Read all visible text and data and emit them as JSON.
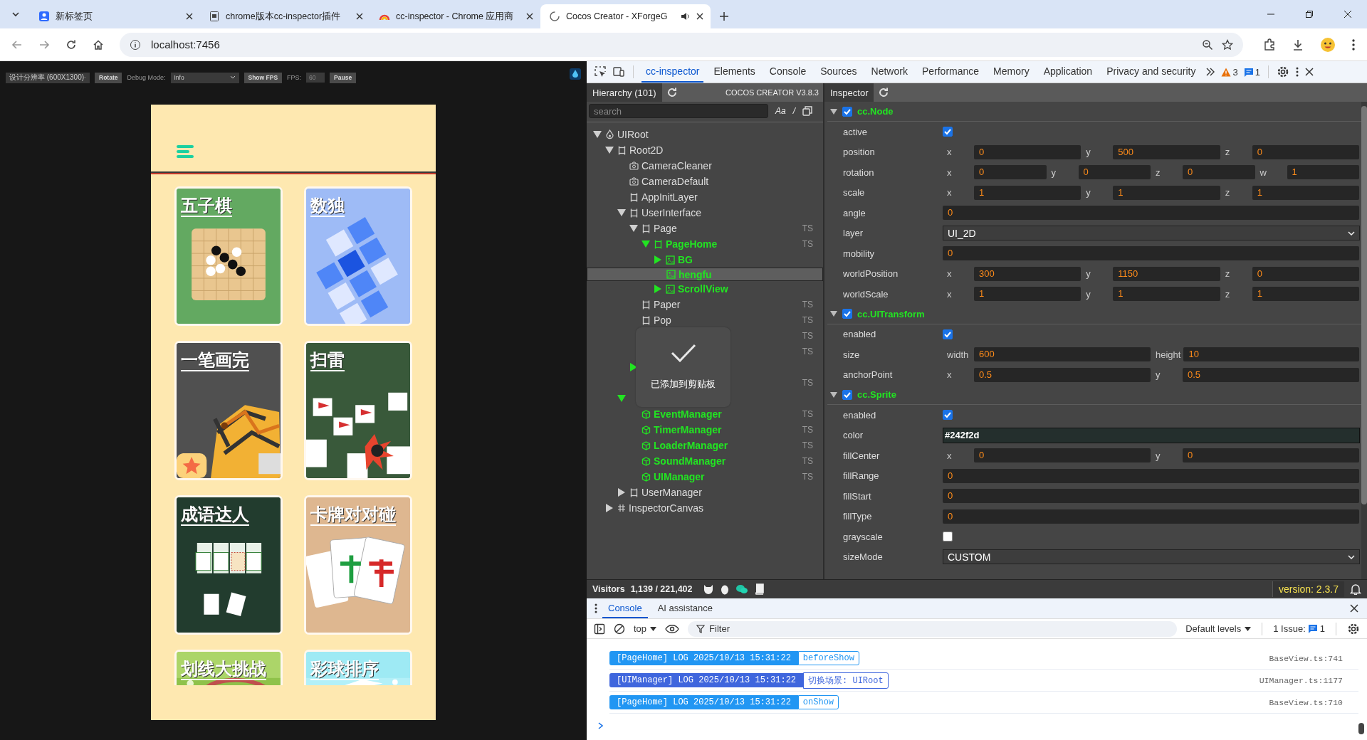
{
  "browser": {
    "tabs": [
      {
        "title": "新标签页",
        "selected": false,
        "audio": false
      },
      {
        "title": "chrome版本cc-inspector插件",
        "selected": false,
        "audio": false
      },
      {
        "title": "cc-inspector - Chrome 应用商",
        "selected": false,
        "audio": false
      },
      {
        "title": "Cocos Creator - XForgeG",
        "selected": true,
        "audio": true
      }
    ],
    "address": "localhost:7456"
  },
  "game": {
    "toolbar": {
      "resolution": "设计分辨率 (600X1300)",
      "rotate": "Rotate",
      "debug_label": "Debug Mode:",
      "debug_value": "Info",
      "show_fps": "Show FPS",
      "fps_label": "FPS:",
      "fps_value": "60",
      "pause": "Pause"
    },
    "cards": [
      {
        "title": "五子棋",
        "color": "#58a355"
      },
      {
        "title": "数独",
        "color": "#97b6f6"
      },
      {
        "title": "一笔画完",
        "color": "#434343"
      },
      {
        "title": "扫雷",
        "color": "#2b4d2c"
      },
      {
        "title": "成语达人",
        "color": "#122e1f"
      },
      {
        "title": "卡牌对对碰",
        "color": "#dcb288"
      },
      {
        "title": "划线大挑战",
        "color": "#a6d25e"
      },
      {
        "title": "彩球排序",
        "color": "#97e9f4"
      }
    ]
  },
  "devtools": {
    "tabs": [
      {
        "label": "cc-inspector",
        "selected": true
      },
      {
        "label": "Elements",
        "selected": false
      },
      {
        "label": "Console",
        "selected": false
      },
      {
        "label": "Sources",
        "selected": false
      },
      {
        "label": "Network",
        "selected": false
      },
      {
        "label": "Performance",
        "selected": false
      },
      {
        "label": "Memory",
        "selected": false
      },
      {
        "label": "Application",
        "selected": false
      },
      {
        "label": "Privacy and security",
        "selected": false
      }
    ],
    "warnings": "3",
    "messages": "1"
  },
  "hierarchy": {
    "tab": "Hierarchy (101)",
    "engine": "COCOS CREATOR V3.8.3",
    "search_placeholder": "search",
    "tools": [
      "Aa",
      "/"
    ],
    "tree": [
      {
        "name": "UIRoot",
        "kind": "root",
        "expanded": true,
        "active": false,
        "selected": false,
        "children": [
          {
            "name": "Root2D",
            "kind": "node",
            "expanded": true,
            "active": false,
            "selected": false,
            "children": [
              {
                "name": "CameraCleaner",
                "kind": "camera",
                "active": false,
                "selected": false
              },
              {
                "name": "CameraDefault",
                "kind": "camera",
                "active": false,
                "selected": false
              },
              {
                "name": "AppInitLayer",
                "kind": "node",
                "active": false,
                "selected": false
              },
              {
                "name": "UserInterface",
                "kind": "node",
                "expanded": true,
                "active": false,
                "selected": false,
                "children": [
                  {
                    "name": "Page",
                    "kind": "node",
                    "expanded": true,
                    "active": false,
                    "selected": false,
                    "tag": "TS",
                    "children": [
                      {
                        "name": "PageHome",
                        "kind": "node",
                        "expanded": true,
                        "active": true,
                        "selected": false,
                        "tag": "TS",
                        "children": [
                          {
                            "name": "BG",
                            "kind": "sprite",
                            "expanded": false,
                            "active": true,
                            "selected": false
                          },
                          {
                            "name": "hengfu",
                            "kind": "sprite",
                            "active": true,
                            "selected": true
                          },
                          {
                            "name": "ScrollView",
                            "kind": "sprite",
                            "expanded": false,
                            "active": true,
                            "selected": false
                          }
                        ]
                      }
                    ]
                  },
                  {
                    "name": "Paper",
                    "kind": "node",
                    "active": false,
                    "selected": false,
                    "tag": "TS"
                  },
                  {
                    "name": "Pop",
                    "kind": "node",
                    "active": false,
                    "selected": false,
                    "tag": "TS"
                  },
                  {
                    "active": false,
                    "selected": false,
                    "tag": "TS"
                  },
                  {
                    "active": false,
                    "selected": false,
                    "tag": "TS"
                  },
                  {
                    "expanded": false,
                    "active": true,
                    "selected": false
                  },
                  {
                    "active": false,
                    "selected": false,
                    "tag": "TS"
                  }
                ]
              },
              {
                "expanded": true,
                "active": true,
                "selected": false,
                "children": [
                  {
                    "name": "EventManager",
                    "kind": "component",
                    "active": true,
                    "selected": false,
                    "tag": "TS"
                  },
                  {
                    "name": "TimerManager",
                    "kind": "component",
                    "active": true,
                    "selected": false,
                    "tag": "TS"
                  },
                  {
                    "name": "LoaderManager",
                    "kind": "component",
                    "active": true,
                    "selected": false,
                    "tag": "TS"
                  },
                  {
                    "name": "SoundManager",
                    "kind": "component",
                    "active": true,
                    "selected": false,
                    "tag": "TS"
                  },
                  {
                    "name": "UIManager",
                    "kind": "component",
                    "active": true,
                    "selected": false,
                    "tag": "TS"
                  }
                ]
              },
              {
                "name": "UserManager",
                "kind": "node",
                "expanded": false,
                "active": false,
                "selected": false
              }
            ]
          },
          {
            "name": "InspectorCanvas",
            "kind": "canvas",
            "expanded": false,
            "active": false,
            "selected": false
          }
        ]
      }
    ]
  },
  "toast": {
    "text": "已添加到剪贴板"
  },
  "inspector": {
    "tab": "Inspector",
    "components": [
      {
        "name": "cc.Node",
        "enabled": true,
        "expanded": true,
        "props": [
          {
            "label": "active",
            "kind": "check",
            "checked": true
          },
          {
            "label": "position",
            "kind": "vector",
            "fields": [
              {
                "axis": "x",
                "value": "0"
              },
              {
                "axis": "y",
                "value": "500"
              },
              {
                "axis": "z",
                "value": "0"
              }
            ]
          },
          {
            "label": "rotation",
            "kind": "vector",
            "fields": [
              {
                "axis": "x",
                "value": "0"
              },
              {
                "axis": "y",
                "value": "0"
              },
              {
                "axis": "z",
                "value": "0"
              },
              {
                "axis": "w",
                "value": "1"
              }
            ]
          },
          {
            "label": "scale",
            "kind": "vector",
            "fields": [
              {
                "axis": "x",
                "value": "1"
              },
              {
                "axis": "y",
                "value": "1"
              },
              {
                "axis": "z",
                "value": "1"
              }
            ]
          },
          {
            "label": "angle",
            "kind": "number",
            "value": "0"
          },
          {
            "label": "layer",
            "kind": "select",
            "value": "UI_2D"
          },
          {
            "label": "mobility",
            "kind": "number",
            "value": "0"
          },
          {
            "label": "worldPosition",
            "kind": "vector",
            "fields": [
              {
                "axis": "x",
                "value": "300"
              },
              {
                "axis": "y",
                "value": "1150"
              },
              {
                "axis": "z",
                "value": "0"
              }
            ]
          },
          {
            "label": "worldScale",
            "kind": "vector",
            "fields": [
              {
                "axis": "x",
                "value": "1"
              },
              {
                "axis": "y",
                "value": "1"
              },
              {
                "axis": "z",
                "value": "1"
              }
            ]
          }
        ]
      },
      {
        "name": "cc.UITransform",
        "enabled": true,
        "expanded": true,
        "props": [
          {
            "label": "enabled",
            "kind": "check",
            "checked": true
          },
          {
            "label": "size",
            "kind": "vector",
            "fields": [
              {
                "axis": "width",
                "value": "600"
              },
              {
                "axis": "height",
                "value": "10"
              }
            ]
          },
          {
            "label": "anchorPoint",
            "kind": "vector",
            "fields": [
              {
                "axis": "x",
                "value": "0.5"
              },
              {
                "axis": "y",
                "value": "0.5"
              }
            ]
          }
        ]
      },
      {
        "name": "cc.Sprite",
        "enabled": true,
        "expanded": true,
        "props": [
          {
            "label": "enabled",
            "kind": "check",
            "checked": true
          },
          {
            "label": "color",
            "kind": "color",
            "value": "#242f2d"
          },
          {
            "label": "fillCenter",
            "kind": "vector",
            "fields": [
              {
                "axis": "x",
                "value": "0"
              },
              {
                "axis": "y",
                "value": "0"
              }
            ]
          },
          {
            "label": "fillRange",
            "kind": "number",
            "value": "0"
          },
          {
            "label": "fillStart",
            "kind": "number",
            "value": "0"
          },
          {
            "label": "fillType",
            "kind": "number",
            "value": "0"
          },
          {
            "label": "grayscale",
            "kind": "check",
            "checked": false
          },
          {
            "label": "sizeMode",
            "kind": "select",
            "value": "CUSTOM"
          }
        ]
      }
    ]
  },
  "footer": {
    "visitors_label": "Visitors",
    "visitors": "1,139 / 221,402",
    "version": "version: 2.3.7"
  },
  "console": {
    "tabs": [
      {
        "label": "Console",
        "selected": true
      },
      {
        "label": "AI assistance",
        "selected": false
      }
    ],
    "context": "top",
    "filter_placeholder": "Filter",
    "levels": "Default levels",
    "issues_label": "1 Issue:",
    "issues_count": "1",
    "logs": [
      {
        "tag": "[PageHome] LOG 2025/10/13 15:31:22",
        "message": "beforeShow",
        "source": "BaseView.ts:741",
        "color": "#2196f3"
      },
      {
        "tag": "[UIManager] LOG 2025/10/13 15:31:22",
        "message": "切换场景: UIRoot",
        "source": "UIManager.ts:1177",
        "color": "#3f66dd"
      },
      {
        "tag": "[PageHome] LOG 2025/10/13 15:31:22",
        "message": "onShow",
        "source": "BaseView.ts:710",
        "color": "#2196f3"
      }
    ]
  }
}
